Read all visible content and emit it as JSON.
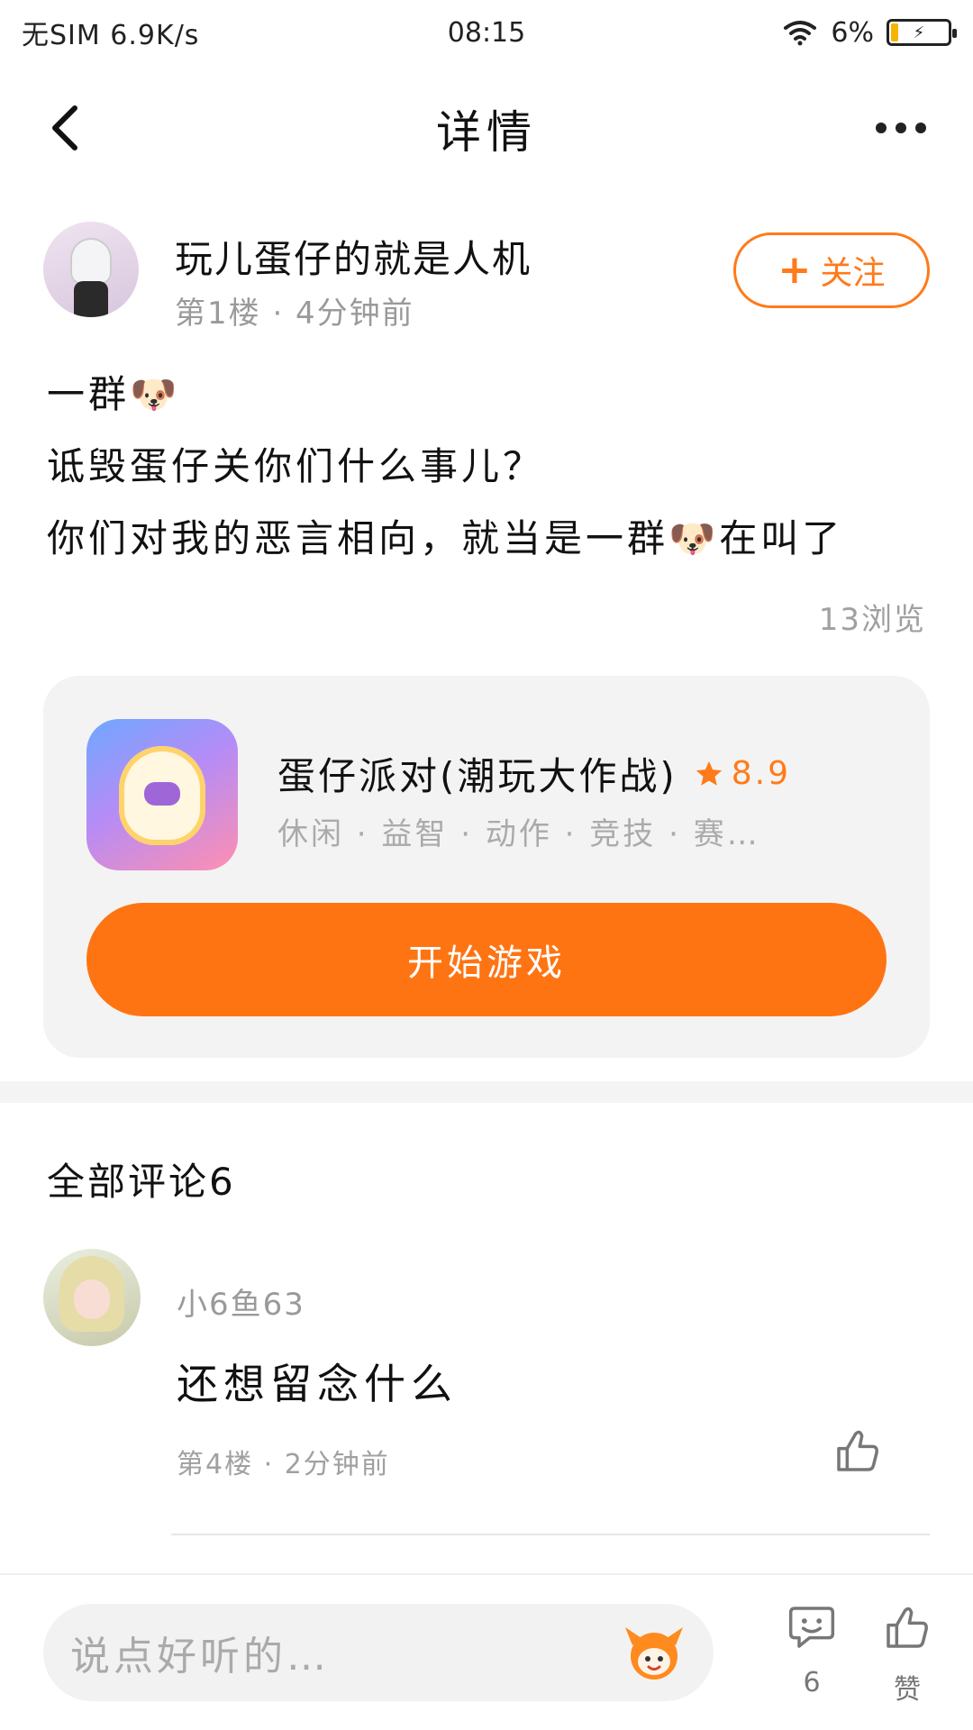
{
  "status_bar": {
    "left": "无SIM 6.9K/s",
    "time": "08:15",
    "battery": "6%"
  },
  "header": {
    "title": "详情"
  },
  "post": {
    "author": "玩儿蛋仔的就是人机",
    "meta": "第1楼 · 4分钟前",
    "follow_label": "关注",
    "lines": [
      "一群🐶",
      "诋毁蛋仔关你们什么事儿？",
      "你们对我的恶言相向，就当是一群🐶在叫了"
    ],
    "views": "13浏览"
  },
  "game": {
    "name": "蛋仔派对(潮玩大作战)",
    "rating": "8.9",
    "tags": "休闲 · 益智 · 动作 · 竞技 · 赛…",
    "play_label": "开始游戏"
  },
  "comments": {
    "title": "全部评论6",
    "items": [
      {
        "user": "小6鱼63",
        "text": "还想留念什么",
        "meta": "第4楼 · 2分钟前"
      }
    ]
  },
  "bottom_bar": {
    "input_placeholder": "说点好听的…",
    "comment_count": "6",
    "like_label": "赞"
  },
  "colors": {
    "accent": "#ff7412",
    "muted_text": "#9a9a9a",
    "card_bg": "#f3f3f3"
  }
}
